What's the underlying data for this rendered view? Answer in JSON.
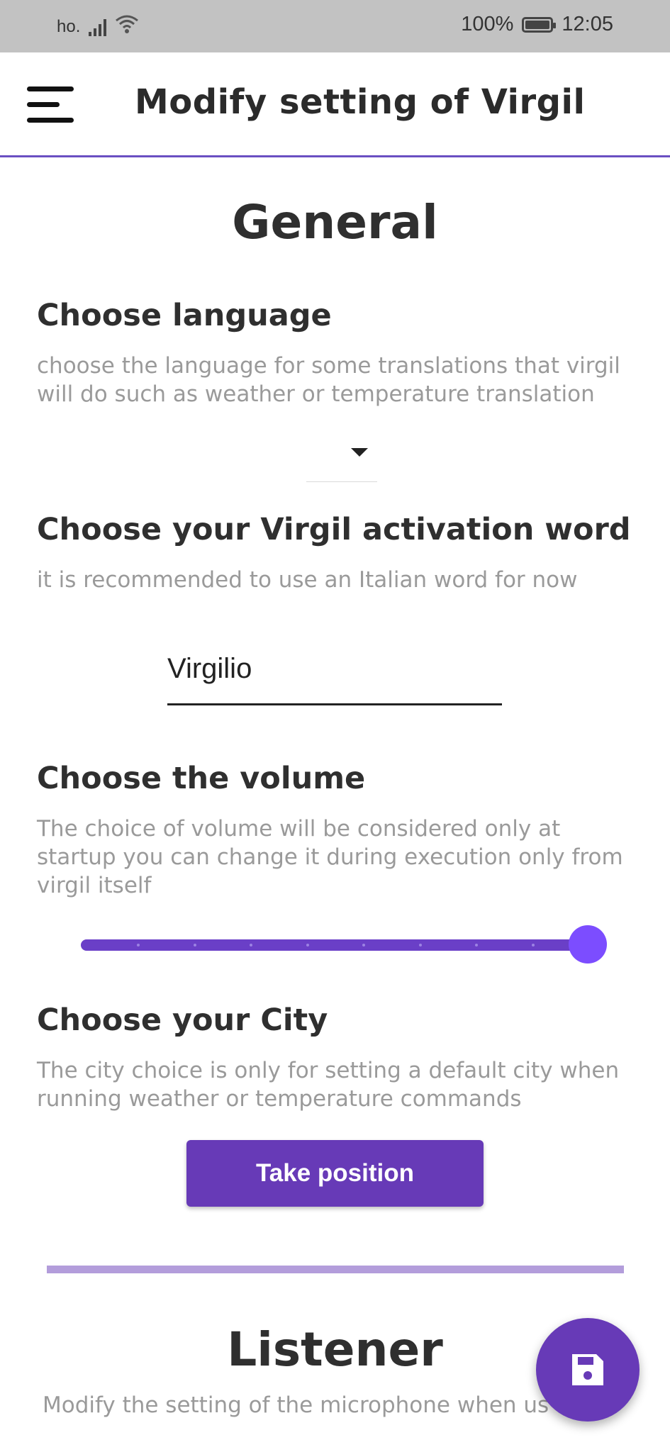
{
  "status_bar": {
    "carrier": "ho.",
    "battery": "100%",
    "time": "12:05"
  },
  "app_bar": {
    "title": "Modify setting of Virgil",
    "menu_icon": "menu-icon"
  },
  "general": {
    "title": "General",
    "language": {
      "title": "Choose language",
      "description": "choose the language for some translations that virgil will do such as weather or temperature translation",
      "selected": ""
    },
    "activation_word": {
      "title": "Choose your Virgil activation word",
      "description": "it is recommended to use an Italian word for now",
      "value": "Virgilio"
    },
    "volume": {
      "title": "Choose the volume",
      "description": "The choice of volume will be considered only at startup you can change it during execution only from virgil itself",
      "level": 1.0,
      "divisions": 9
    },
    "city": {
      "title": "Choose your City",
      "description": "The city choice is only for setting a default city when running weather or temperature commands",
      "button_label": "Take position"
    }
  },
  "listener": {
    "title": "Listener",
    "description": "Modify the setting of the microphone when us"
  },
  "fab": {
    "icon": "save-icon"
  },
  "colors": {
    "accent": "#673ab7",
    "slider_thumb": "#7c4dff",
    "divider": "#b39ddb"
  }
}
